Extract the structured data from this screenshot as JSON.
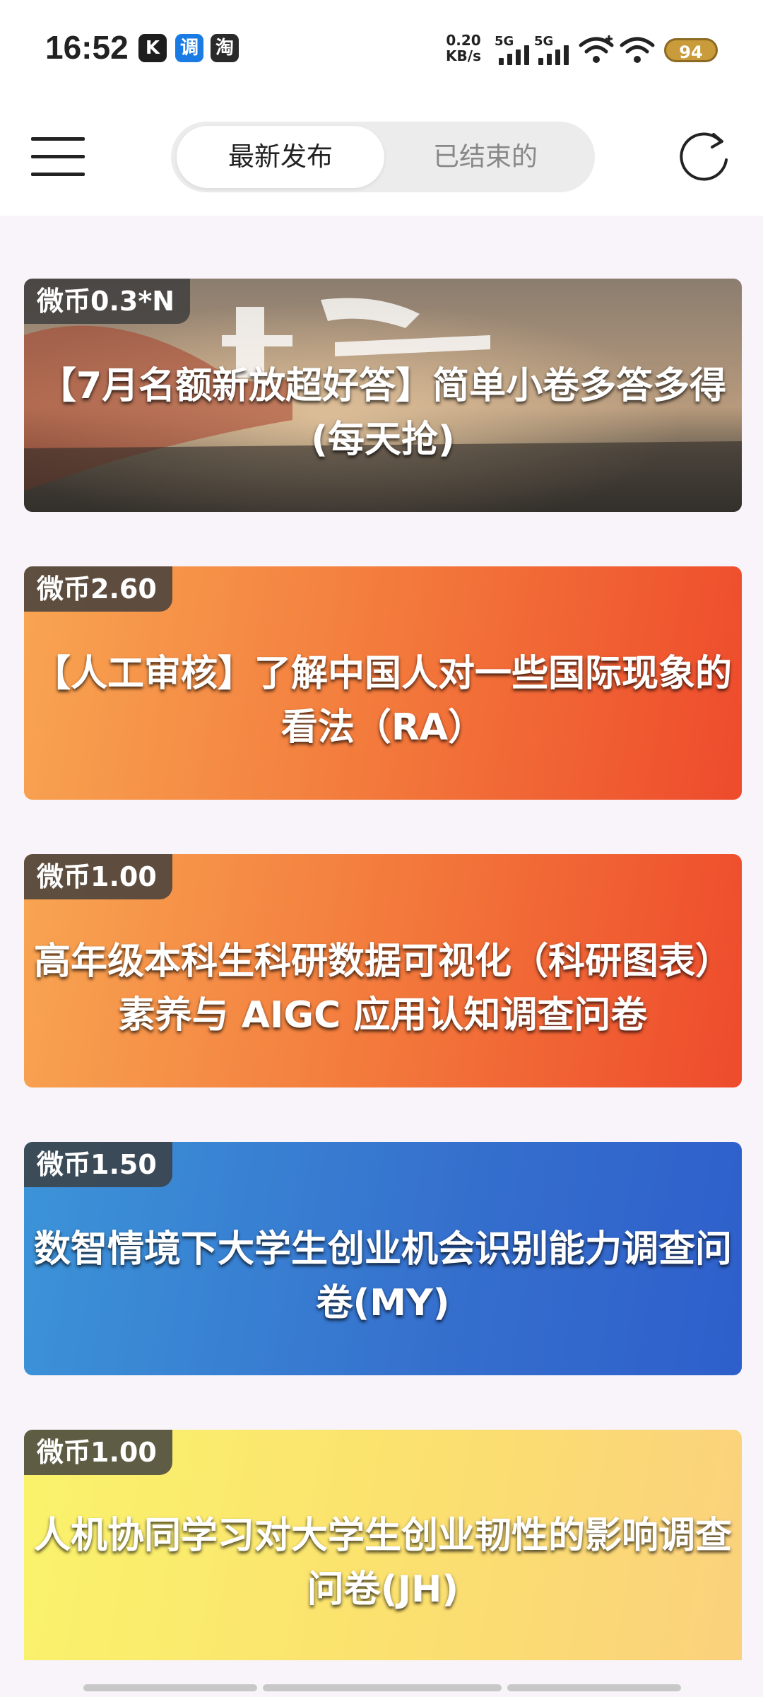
{
  "status": {
    "time": "16:52",
    "apps": [
      "K",
      "调",
      "淘"
    ],
    "net_speed_value": "0.20",
    "net_speed_unit": "KB/s",
    "signal_labels": [
      "5G",
      "5G"
    ],
    "battery": "94"
  },
  "header": {
    "tabs": [
      {
        "label": "最新发布",
        "active": true
      },
      {
        "label": "已结束的",
        "active": false
      }
    ]
  },
  "cards": [
    {
      "reward": "微币0.3*N",
      "title": "【7月名额新放超好答】简单小卷多答多得(每天抢)",
      "bg": "photo"
    },
    {
      "reward": "微币2.60",
      "title": "【人工审核】了解中国人对一些国际现象的看法（RA）",
      "bg": "orange"
    },
    {
      "reward": "微币1.00",
      "title": "高年级本科生科研数据可视化（科研图表）素养与 AIGC 应用认知调查问卷",
      "bg": "orange"
    },
    {
      "reward": "微币1.50",
      "title": "数智情境下大学生创业机会识别能力调查问卷(MY)",
      "bg": "blue"
    },
    {
      "reward": "微币1.00",
      "title": "人机协同学习对大学生创业韧性的影响调查问卷(JH)",
      "bg": "yellow"
    }
  ],
  "colors": {
    "orange_start": "#f7a04e",
    "orange_end": "#ee4a2e",
    "blue_start": "#3a8fd6",
    "blue_end": "#2f62c9",
    "yellow_start": "#f9f06a",
    "yellow_end": "#fbd27a"
  }
}
